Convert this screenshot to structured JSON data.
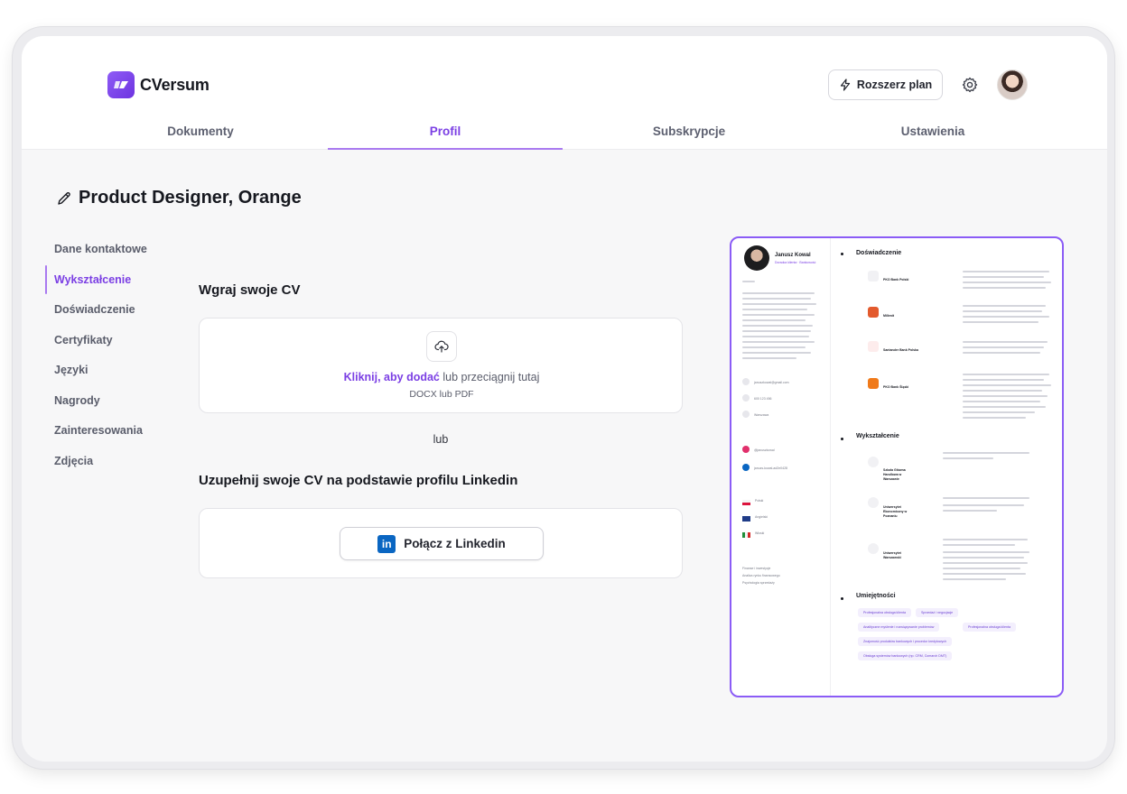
{
  "app": {
    "name": "CVersum",
    "upgrade_label": "Rozszerz plan"
  },
  "tabs": [
    {
      "label": "Dokumenty",
      "active": false
    },
    {
      "label": "Profil",
      "active": true
    },
    {
      "label": "Subskrypcje",
      "active": false
    },
    {
      "label": "Ustawienia",
      "active": false
    }
  ],
  "page": {
    "title": "Product Designer, Orange"
  },
  "sidebar": {
    "items": [
      {
        "label": "Dane kontaktowe",
        "active": false
      },
      {
        "label": "Wykształcenie",
        "active": true
      },
      {
        "label": "Doświadczenie",
        "active": false
      },
      {
        "label": "Certyfikaty",
        "active": false
      },
      {
        "label": "Języki",
        "active": false
      },
      {
        "label": "Nagrody",
        "active": false
      },
      {
        "label": "Zainteresowania",
        "active": false
      },
      {
        "label": "Zdjęcia",
        "active": false
      }
    ]
  },
  "upload": {
    "title": "Wgraj swoje CV",
    "link_text": "Kliknij, aby dodać",
    "rest_text": " lub przeciągnij tutaj",
    "hint": "DOCX lub PDF"
  },
  "or_text": "lub",
  "linkedin": {
    "title": "Uzupełnij swoje CV na podstawie profilu Linkedin",
    "button_label": "Połącz z Linkedin",
    "logo_text": "in"
  },
  "cv": {
    "name": "Janusz Kowal",
    "role": "Doradca klienta · Bankowość",
    "sections": {
      "experience": "Doświadczenie",
      "education": "Wykształcenie",
      "skills": "Umiejętności"
    },
    "companies": [
      "PKO Bank Polski",
      "Millenit",
      "Santander Bank Polska",
      "PKO Bank Śląski"
    ],
    "schools": [
      "Szkoła Główna Handlowa w Warszawie",
      "Uniwersytet Ekonomiczny w Poznaniu",
      "Uniwersytet Warszawski"
    ],
    "skills": [
      "Profesjonalna obsługa klienta",
      "Sprzedaż i negocjacje",
      "Analityczne myślenie i rozwiązywanie problemów",
      "Profesjonalna obsługa klienta",
      "Znajomość produktów bankowych i procedur kredytowych",
      "Obsługa systemów bankowych (np. CRM, Comarch DMT)"
    ],
    "contact": {
      "email": "januszkowal@gmail.com",
      "phone": "600 123 456",
      "city": "Warszawa",
      "instagram": "@januszkowal",
      "linkedin": "januzs-kowal-ad2e0428"
    },
    "languages": [
      "Polski",
      "Angielski",
      "Włoski"
    ],
    "interests": [
      "Finanse i inwestycje",
      "Analiza rynku finansowego",
      "Psychologia sprzedaży"
    ]
  },
  "colors": {
    "accent": "#7b3fe4",
    "accent_light": "#a979f0",
    "linkedin": "#0a66c2"
  }
}
